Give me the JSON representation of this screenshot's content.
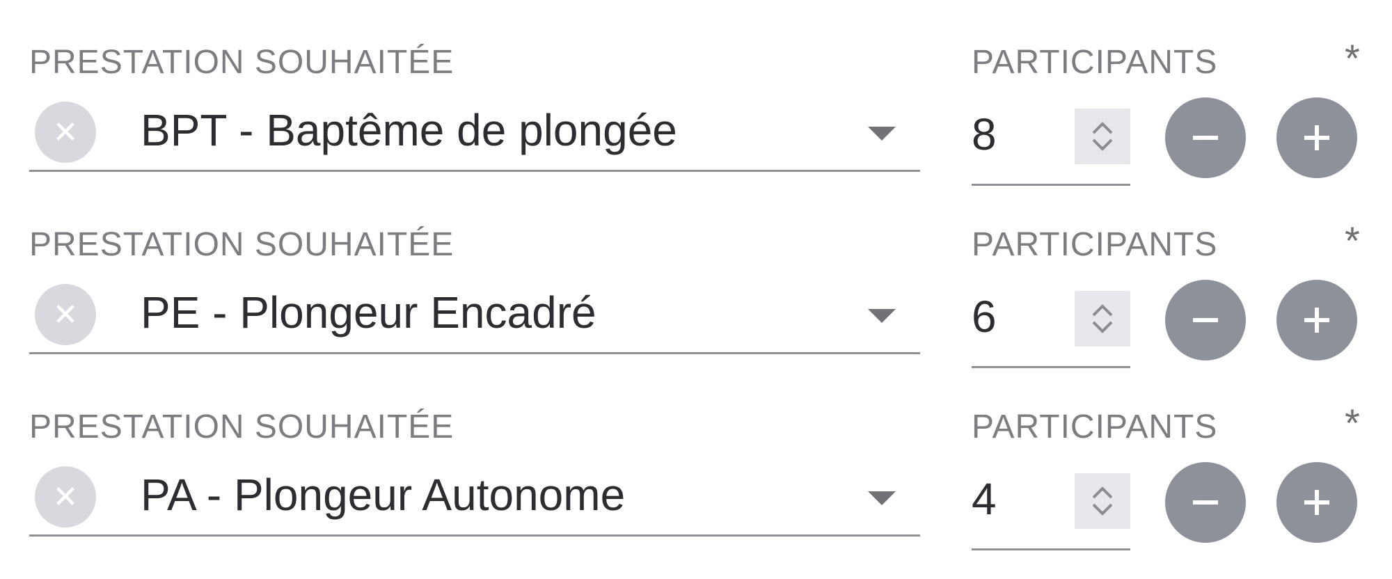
{
  "rows": [
    {
      "prestation_label": "PRESTATION SOUHAITÉE",
      "prestation_value": "BPT - Baptême de plongée",
      "participants_label": "PARTICIPANTS",
      "participants_value": "8",
      "required_mark": "*"
    },
    {
      "prestation_label": "PRESTATION SOUHAITÉE",
      "prestation_value": "PE - Plongeur Encadré",
      "participants_label": "PARTICIPANTS",
      "participants_value": "6",
      "required_mark": "*"
    },
    {
      "prestation_label": "PRESTATION SOUHAITÉE",
      "prestation_value": "PA - Plongeur Autonome",
      "participants_label": "PARTICIPANTS",
      "participants_value": "4",
      "required_mark": "*"
    }
  ],
  "icons": {
    "clear": "close-icon",
    "dropdown": "caret-down-icon",
    "spinner": "spinner-arrows-icon",
    "decrement": "minus-icon",
    "increment": "plus-icon"
  },
  "colors": {
    "label": "#7b7d81",
    "value_text": "#2b2d30",
    "round_button": "#8d9199",
    "clear_button": "#d7d9de"
  }
}
